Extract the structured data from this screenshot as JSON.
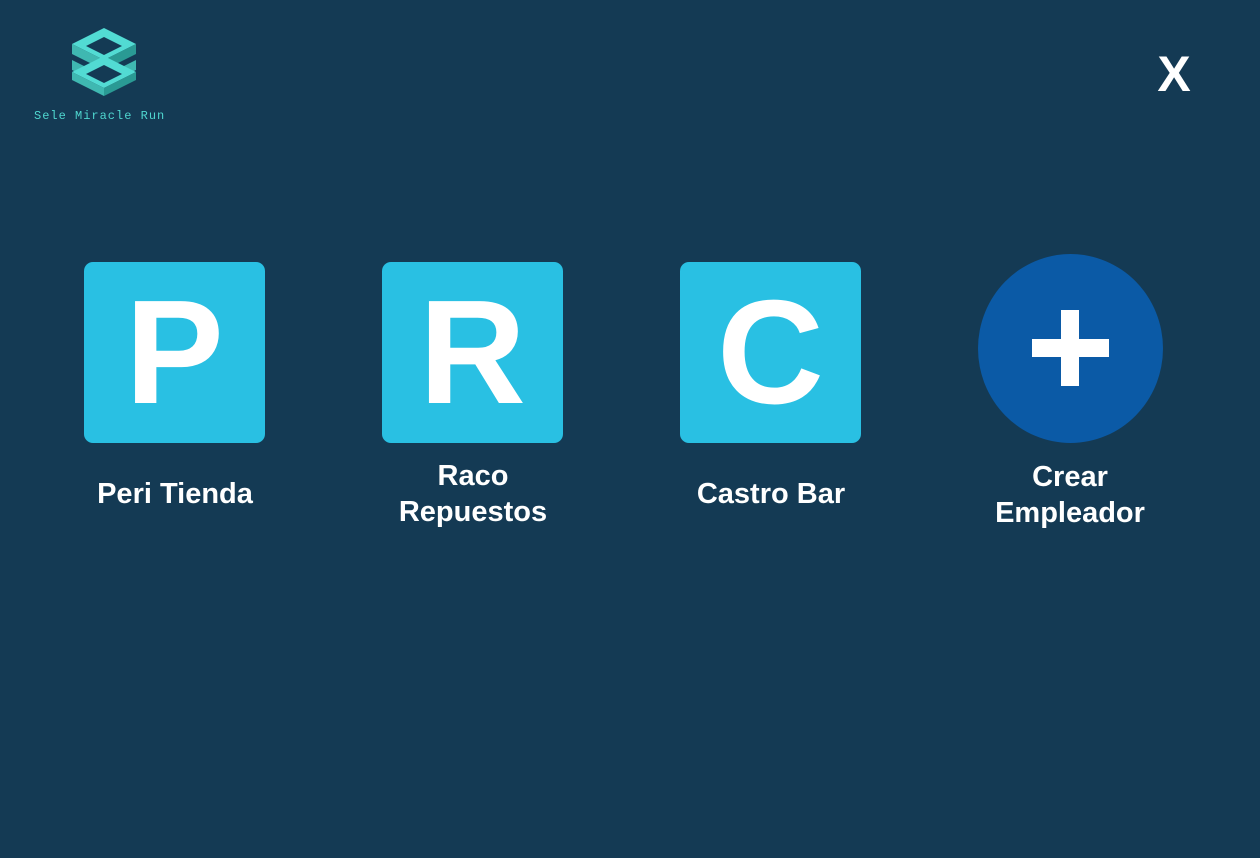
{
  "brand": {
    "name": "Sele Miracle Run",
    "logo_icon": "isometric-logo-icon",
    "accent_color": "#4fd6cf"
  },
  "header": {
    "close_label": "X"
  },
  "colors": {
    "background": "#143a54",
    "tile": "#29c0e3",
    "create": "#0b5aa6"
  },
  "employers": [
    {
      "initial": "P",
      "name": "Peri Tienda"
    },
    {
      "initial": "R",
      "name": "Raco\nRepuestos",
      "name_lines": [
        "Raco",
        "Repuestos"
      ]
    },
    {
      "initial": "C",
      "name": "Castro Bar"
    }
  ],
  "create": {
    "icon": "plus-icon",
    "label_lines": [
      "Crear",
      "Empleador"
    ]
  }
}
